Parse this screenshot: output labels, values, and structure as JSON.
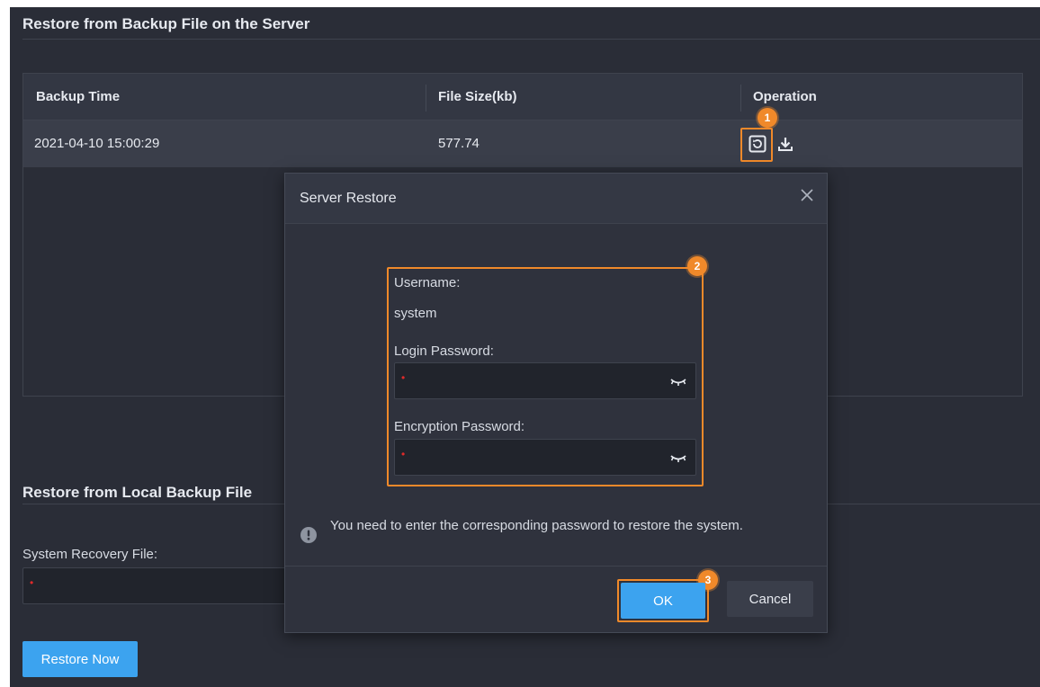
{
  "server_section": {
    "title": "Restore from Backup File on the Server",
    "columns": [
      "Backup Time",
      "File Size(kb)",
      "Operation"
    ],
    "rows": [
      {
        "backup_time": "2021-04-10 15:00:29",
        "file_size": "577.74",
        "operations": [
          "restore-icon",
          "download-icon"
        ]
      }
    ]
  },
  "local_section": {
    "title": "Restore from Local Backup File",
    "file_label": "System Recovery File:",
    "restore_button": "Restore Now"
  },
  "dialog": {
    "title": "Server Restore",
    "username_label": "Username:",
    "username_value": "system",
    "login_password_label": "Login Password:",
    "encryption_password_label": "Encryption Password:",
    "hint": "You need to enter the corresponding password to restore the system.",
    "ok_label": "OK",
    "cancel_label": "Cancel"
  },
  "callouts": [
    "1",
    "2",
    "3"
  ],
  "colors": {
    "panel_bg": "#2a2d37",
    "accent": "#3ca3ef",
    "highlight": "#f0892a",
    "required": "#e02a2a"
  }
}
